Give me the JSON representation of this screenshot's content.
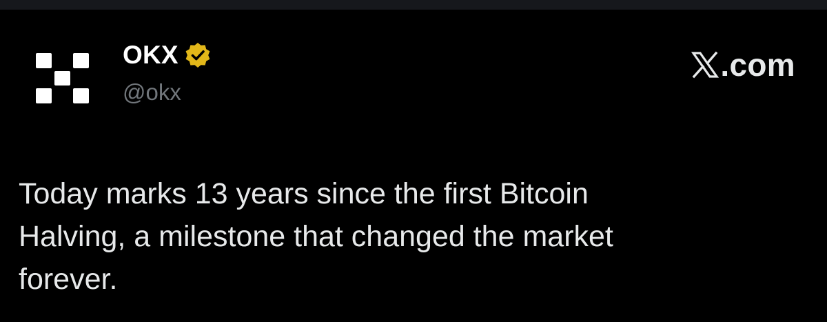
{
  "tweet": {
    "author": {
      "display_name": "OKX",
      "handle": "@okx",
      "verified": true,
      "verified_badge_color": "#e2b719",
      "avatar_icon": "okx-checker-logo-icon"
    },
    "source": {
      "label": ".com",
      "icon": "x-logo-icon"
    },
    "text": "Today marks 13 years since the first Bitcoin\nHalving, a milestone that changed the market\nforever."
  },
  "colors": {
    "background": "#000000",
    "name": "#ffffff",
    "handle": "#71767b",
    "body_text": "#e7e9ea"
  }
}
